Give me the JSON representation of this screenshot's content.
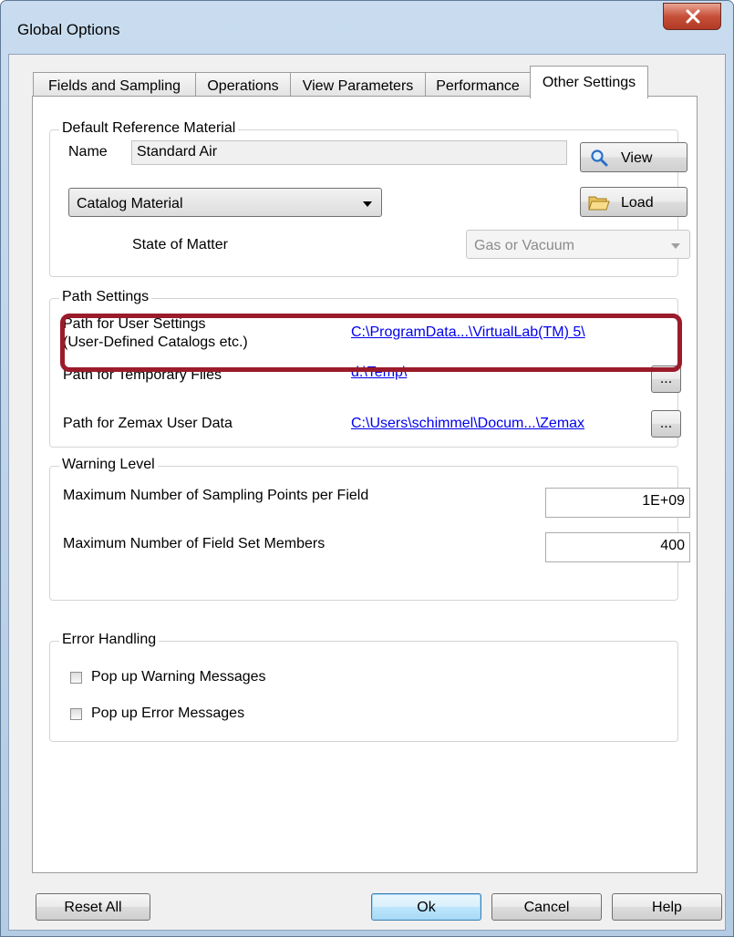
{
  "window": {
    "title": "Global Options"
  },
  "tabs": [
    {
      "label": "Fields and Sampling"
    },
    {
      "label": "Operations"
    },
    {
      "label": "View Parameters"
    },
    {
      "label": "Performance"
    },
    {
      "label": "Other Settings",
      "active": true
    }
  ],
  "default_reference_material": {
    "group_label": "Default Reference Material",
    "name_label": "Name",
    "name_value": "Standard Air",
    "view_button": "View",
    "load_button": "Load",
    "material_type": "Catalog Material",
    "state_label": "State of Matter",
    "state_value": "Gas or Vacuum"
  },
  "path_settings": {
    "group_label": "Path Settings",
    "rows": [
      {
        "label_line1": "Path for User Settings",
        "label_line2": "(User-Defined Catalogs etc.)",
        "path": "C:\\ProgramData...\\VirtualLab(TM) 5\\"
      },
      {
        "label": "Path for Temporary Files",
        "path": "d:\\Temp\\",
        "browse": "..."
      },
      {
        "label": "Path for Zemax User Data",
        "path": "C:\\Users\\schimmel\\Docum...\\Zemax",
        "browse": "..."
      }
    ]
  },
  "warning_level": {
    "group_label": "Warning Level",
    "max_sampling_label": "Maximum Number of Sampling Points per Field",
    "max_sampling_value": "1E+09",
    "max_members_label": "Maximum Number of Field Set Members",
    "max_members_value": "400"
  },
  "error_handling": {
    "group_label": "Error Handling",
    "popup_warning": {
      "label": "Pop up Warning Messages",
      "checked": false
    },
    "popup_error": {
      "label": "Pop up Error Messages",
      "checked": false
    }
  },
  "buttons": {
    "reset_all": "Reset All",
    "ok": "Ok",
    "cancel": "Cancel",
    "help": "Help"
  },
  "colors": {
    "highlight": "#9b1b2a",
    "link": "#0000ee",
    "close_button": "#c7503a"
  }
}
